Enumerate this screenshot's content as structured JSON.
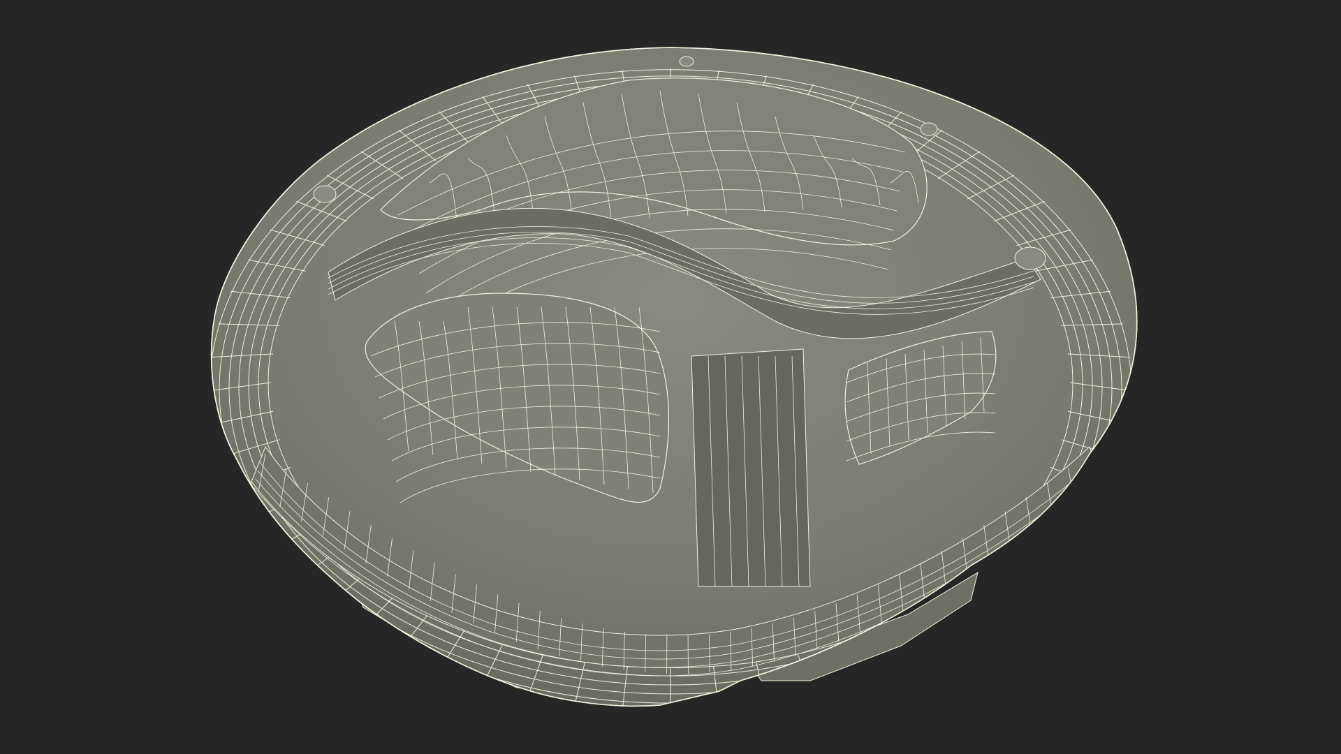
{
  "scene": {
    "background_color": "#262626",
    "surface_color": "#7e7e72",
    "surface_dark_color": "#5e5e55",
    "surface_light_color": "#8d8d81",
    "wire_color": "#f3f0dc"
  }
}
